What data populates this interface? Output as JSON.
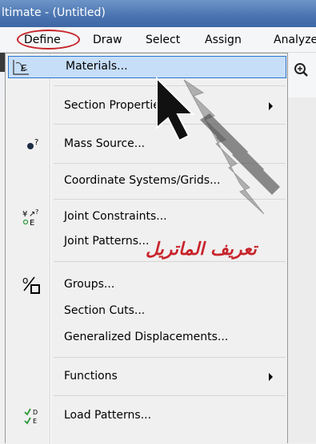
{
  "title": "ltimate  - (Untitled)",
  "menubar": {
    "define": "Define",
    "draw": "Draw",
    "select": "Select",
    "assign": "Assign",
    "analyze": "Analyze"
  },
  "menu": {
    "materials": "Materials...",
    "section_properties": "Section Properties",
    "mass_source": "Mass Source...",
    "coordinate_systems": "Coordinate Systems/Grids...",
    "joint_constraints": "Joint Constraints...",
    "joint_patterns": "Joint Patterns...",
    "groups": "Groups...",
    "section_cuts": "Section Cuts...",
    "generalized_displacements": "Generalized Displacements...",
    "functions": "Functions",
    "load_patterns": "Load Patterns..."
  },
  "annotation": "تعريف الماتريل",
  "colors": {
    "highlight": "#c6def8",
    "highlight_border": "#2a76d0",
    "annotation": "#c8242b"
  }
}
